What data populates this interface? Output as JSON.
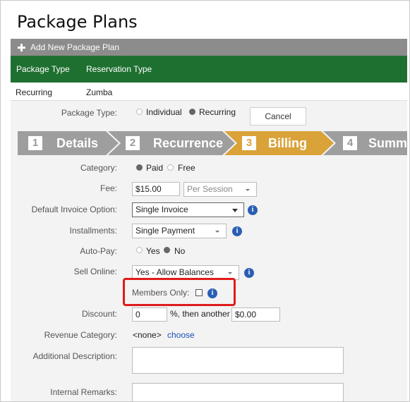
{
  "page_title": "Package Plans",
  "add_bar": {
    "label": "Add New Package Plan"
  },
  "table": {
    "headers": [
      "Package Type",
      "Reservation Type"
    ],
    "row": [
      "Recurring",
      "Zumba"
    ]
  },
  "form": {
    "package_type": {
      "label": "Package Type:",
      "options": [
        "Individual",
        "Recurring"
      ],
      "selected": "Recurring"
    },
    "cancel_label": "Cancel",
    "steps": [
      {
        "num": "1",
        "label": "Details"
      },
      {
        "num": "2",
        "label": "Recurrence"
      },
      {
        "num": "3",
        "label": "Billing"
      },
      {
        "num": "4",
        "label": "Summ"
      }
    ],
    "active_step": "Billing",
    "category": {
      "label": "Category:",
      "options": [
        "Paid",
        "Free"
      ],
      "selected": "Paid"
    },
    "fee": {
      "label": "Fee:",
      "value": "$15.00",
      "per": "Per Session"
    },
    "default_invoice": {
      "label": "Default Invoice Option:",
      "value": "Single Invoice"
    },
    "installments": {
      "label": "Installments:",
      "value": "Single Payment"
    },
    "auto_pay": {
      "label": "Auto-Pay:",
      "options": [
        "Yes",
        "No"
      ],
      "selected": "No"
    },
    "sell_online": {
      "label": "Sell Online:",
      "value": "Yes - Allow Balances"
    },
    "members_only": {
      "label": "Members Only:",
      "checked": false
    },
    "discount": {
      "label": "Discount:",
      "value": "0",
      "mid_text": "%, then another",
      "amount": "$0.00"
    },
    "revenue_category": {
      "label": "Revenue Category:",
      "value": "<none>",
      "link": "choose"
    },
    "additional_description": {
      "label": "Additional Description:"
    },
    "internal_remarks": {
      "label": "Internal Remarks:"
    }
  },
  "colors": {
    "header_green": "#1e7030",
    "add_bar_gray": "#8c8c8c",
    "step_gray": "#9e9e9e",
    "step_active": "#d9a33a",
    "highlight_red": "#e01b1b",
    "info_blue": "#2a5fb3",
    "link_blue": "#1a4fb8"
  },
  "icons": [
    "plus-icon",
    "info-icon",
    "chevron-down-icon",
    "checkbox-icon",
    "radio-icon"
  ]
}
